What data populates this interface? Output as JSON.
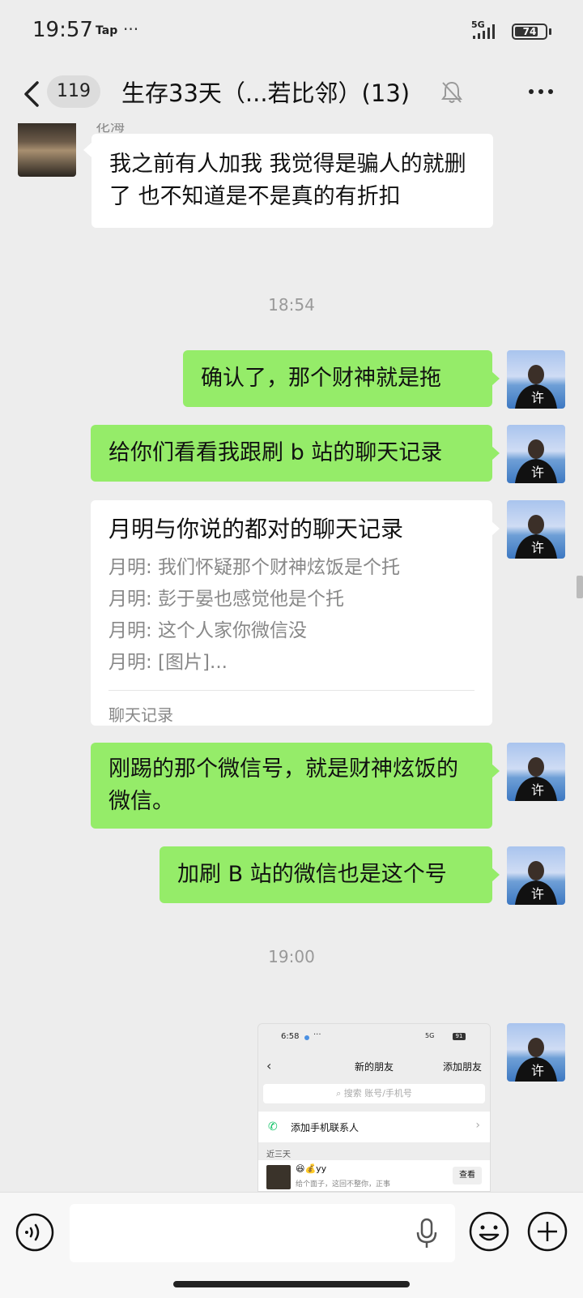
{
  "status_bar": {
    "time": "19:57",
    "notification_app": "Tap",
    "more_dots": "···",
    "network": "5G",
    "battery": "74"
  },
  "nav": {
    "unread_count": "119",
    "title": "生存33天（...若比邻）(13)"
  },
  "messages": {
    "other_1": {
      "sender": "花海",
      "text": "我之前有人加我 我觉得是骗人的就删了 也不知道是不是真的有折扣"
    },
    "time_1": "18:54",
    "self_1": "确认了，那个财神就是拖",
    "self_2": "给你们看看我跟刷 b 站的聊天记录",
    "chat_record": {
      "title": "月明与你说的都对的聊天记录",
      "lines": [
        "月明: 我们怀疑那个财神炫饭是个托",
        "月明: 彭于晏也感觉他是个托",
        "月明: 这个人家你微信没",
        "月明: [图片]..."
      ],
      "footer": "聊天记录"
    },
    "self_3": "刚踢的那个微信号，就是财神炫饭的微信。",
    "self_4": "加刷 B 站的微信也是这个号",
    "time_2": "19:00",
    "screenshot": {
      "time": "6:58",
      "dots": "···",
      "sys_icons": "5G",
      "battery": "91",
      "back": "‹",
      "title": "新的朋友",
      "add_friend": "添加朋友",
      "search_placeholder": "搜索 账号/手机号",
      "add_contacts": "添加手机联系人",
      "section": "近三天",
      "friend_name": "😆💰yy",
      "friend_message": "给个面子，这回不整你，正事",
      "view_button": "查看"
    }
  },
  "input_bar": {
    "placeholder": ""
  }
}
